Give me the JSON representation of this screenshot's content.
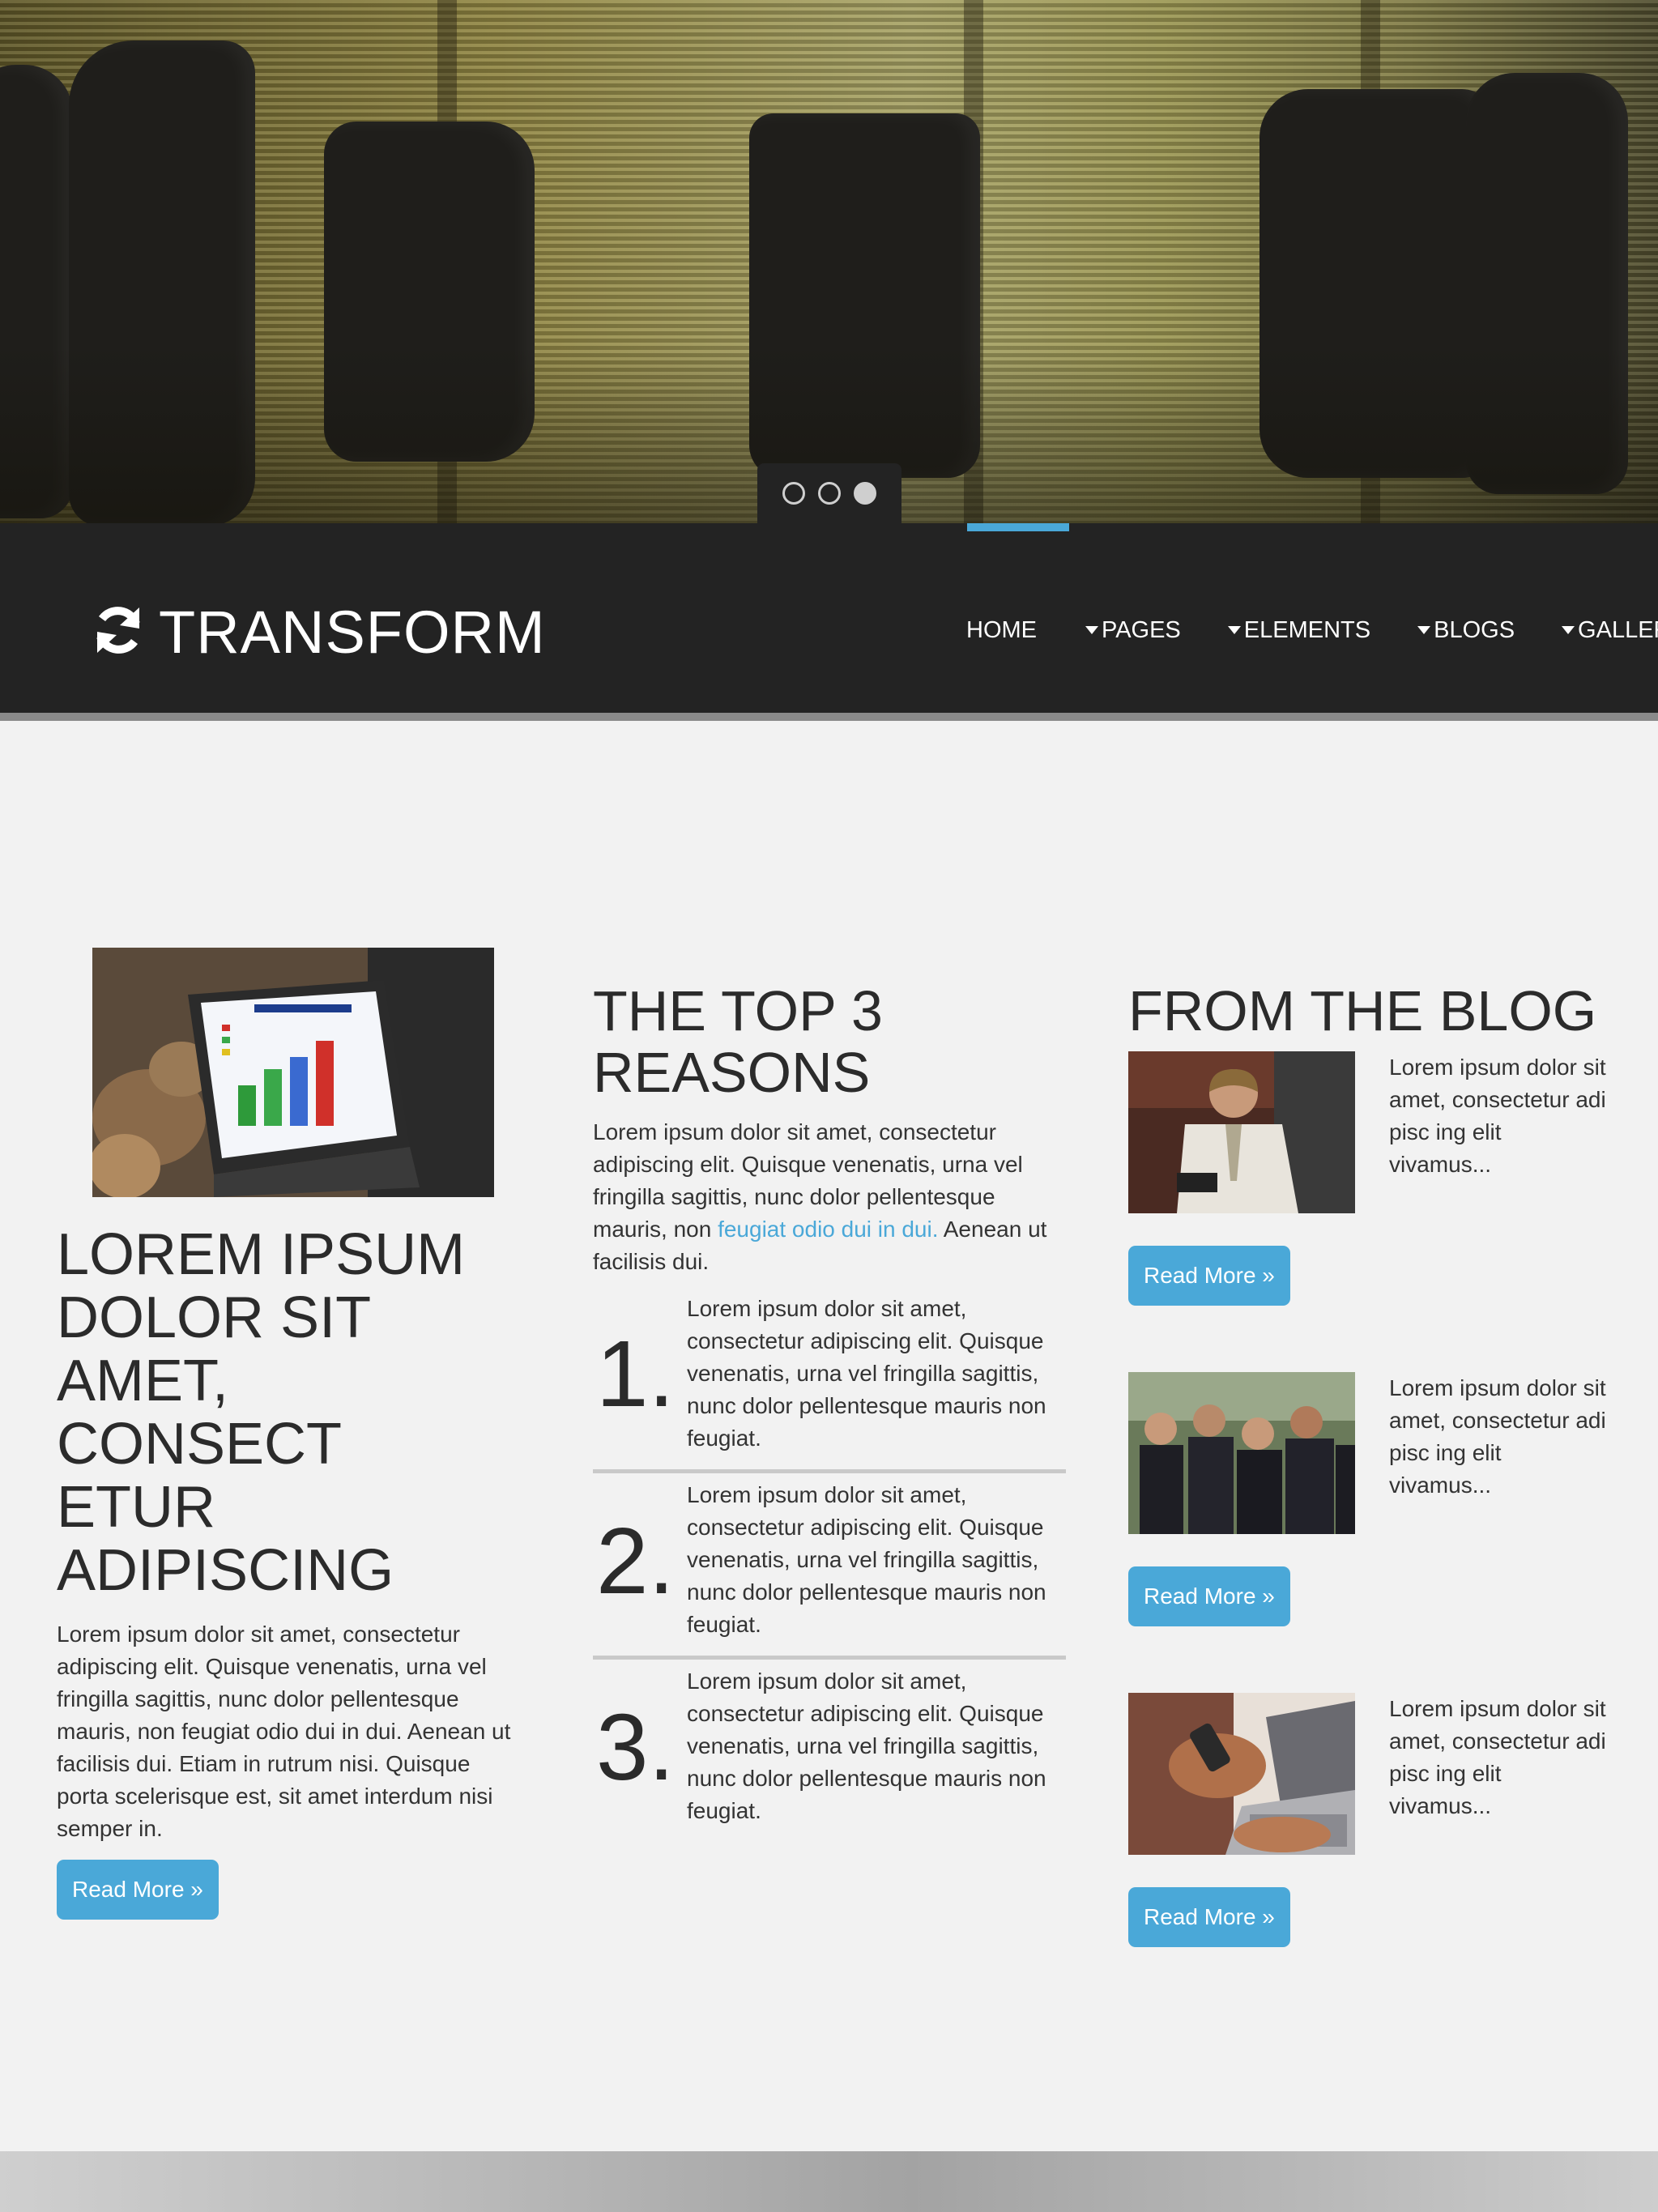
{
  "hero": {
    "slides": [
      {
        "label": "slide-1",
        "active": false
      },
      {
        "label": "slide-2",
        "active": false
      },
      {
        "label": "slide-3",
        "active": true
      }
    ]
  },
  "navbar": {
    "logo_text": "TRANSFORM",
    "items": [
      {
        "label": "HOME",
        "has_caret": false,
        "active": true
      },
      {
        "label": "PAGES",
        "has_caret": true,
        "active": false
      },
      {
        "label": "ELEMENTS",
        "has_caret": true,
        "active": false
      },
      {
        "label": "BLOGS",
        "has_caret": true,
        "active": false
      },
      {
        "label": "GALLERY",
        "has_caret": true,
        "active": false
      }
    ],
    "accent_color": "#4aa8d8"
  },
  "feature": {
    "heading": "LOREM IPSUM DOLOR SIT AMET, CONSECT ETUR ADIPISCING",
    "heading_lines": [
      "LOREM IPSUM",
      "DOLOR SIT",
      "AMET, CONSECT",
      "ETUR",
      "ADIPISCING"
    ],
    "body": "Lorem ipsum dolor sit amet, consectetur adipiscing elit. Quisque venenatis, urna vel fringilla sagittis, nunc dolor pellentesque mauris, non feugiat odio dui in dui. Aenean ut facilisis dui. Etiam in rutrum nisi. Quisque porta scelerisque est, sit amet interdum nisi semper in.",
    "button": "Read More »"
  },
  "reasons": {
    "heading_line1": "THE TOP 3",
    "heading_line2": "REASONS",
    "intro_before": "Lorem ipsum dolor sit amet, consectetur adipiscing elit. Quisque venenatis, urna vel fringilla sagittis, nunc dolor pellentesque mauris, non ",
    "intro_link": "feugiat odio dui in dui.",
    "intro_after": " Aenean ut facilisis dui.",
    "items": [
      {
        "number": "1.",
        "text": "Lorem ipsum dolor sit amet, consectetur adipiscing elit. Quisque venenatis, urna vel fringilla sagittis, nunc dolor pellentesque mauris non feugiat."
      },
      {
        "number": "2.",
        "text": "Lorem ipsum dolor sit amet, consectetur adipiscing elit. Quisque venenatis, urna vel fringilla sagittis, nunc dolor pellentesque mauris non feugiat."
      },
      {
        "number": "3.",
        "text": "Lorem ipsum dolor sit amet, consectetur adipiscing elit. Quisque venenatis, urna vel fringilla sagittis, nunc dolor pellentesque mauris non feugiat."
      }
    ]
  },
  "blog": {
    "heading": "FROM THE BLOG",
    "posts": [
      {
        "excerpt": "Lorem ipsum dolor sit amet, consectetur adi pisc ing elit vivamus...",
        "button": "Read More »"
      },
      {
        "excerpt": "Lorem ipsum dolor sit amet, consectetur adi pisc ing elit vivamus...",
        "button": "Read More »"
      },
      {
        "excerpt": "Lorem ipsum dolor sit amet, consectetur adi pisc ing elit vivamus...",
        "button": "Read More »"
      }
    ]
  }
}
